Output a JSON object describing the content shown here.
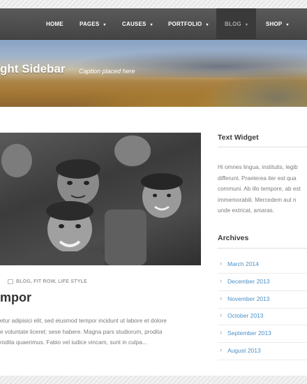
{
  "nav": {
    "items": [
      {
        "label": "HOME",
        "caret": false
      },
      {
        "label": "PAGES",
        "caret": true
      },
      {
        "label": "CAUSES",
        "caret": true
      },
      {
        "label": "PORTFOLIO",
        "caret": true
      },
      {
        "label": "BLOG",
        "caret": true,
        "active": true
      },
      {
        "label": "SHOP",
        "caret": true
      }
    ],
    "caret_glyph": "▾"
  },
  "hero": {
    "title": "ght Sidebar",
    "caption": "Caption placed here"
  },
  "post": {
    "meta": "BLOG, FIT ROW, LIFE STYLE",
    "meta_icon": "folder-icon",
    "title": "mpor",
    "excerpt_lines": [
      "etur adipisici elit, sed eiusmod tempor incidunt ut labore et dolore",
      "e voluntate liceret: sese habere. Magna pars studiorum, prodita",
      "rodita quaerimus. Fabio vel iudice vincam, sunt in culpa..."
    ]
  },
  "sidebar": {
    "text_widget": {
      "title": "Text Widget",
      "lines": [
        "Hi omnes lingua, institutis, legib",
        "differunt. Praeterea iter est qua",
        "communi. Ab illo tempore, ab est",
        "immemorabili. Mercedem aut n",
        "unde extricat, amaras."
      ]
    },
    "archives": {
      "title": "Archives",
      "chevron_glyph": "›",
      "items": [
        "March 2014",
        "December 2013",
        "November 2013",
        "October 2013",
        "September 2013",
        "August 2013"
      ]
    }
  },
  "colors": {
    "nav_bg": "#4c4c4c",
    "nav_active_bg": "#3a3a3a",
    "link": "#4a90c8",
    "heading": "#333333",
    "text": "#7a7a7a"
  }
}
